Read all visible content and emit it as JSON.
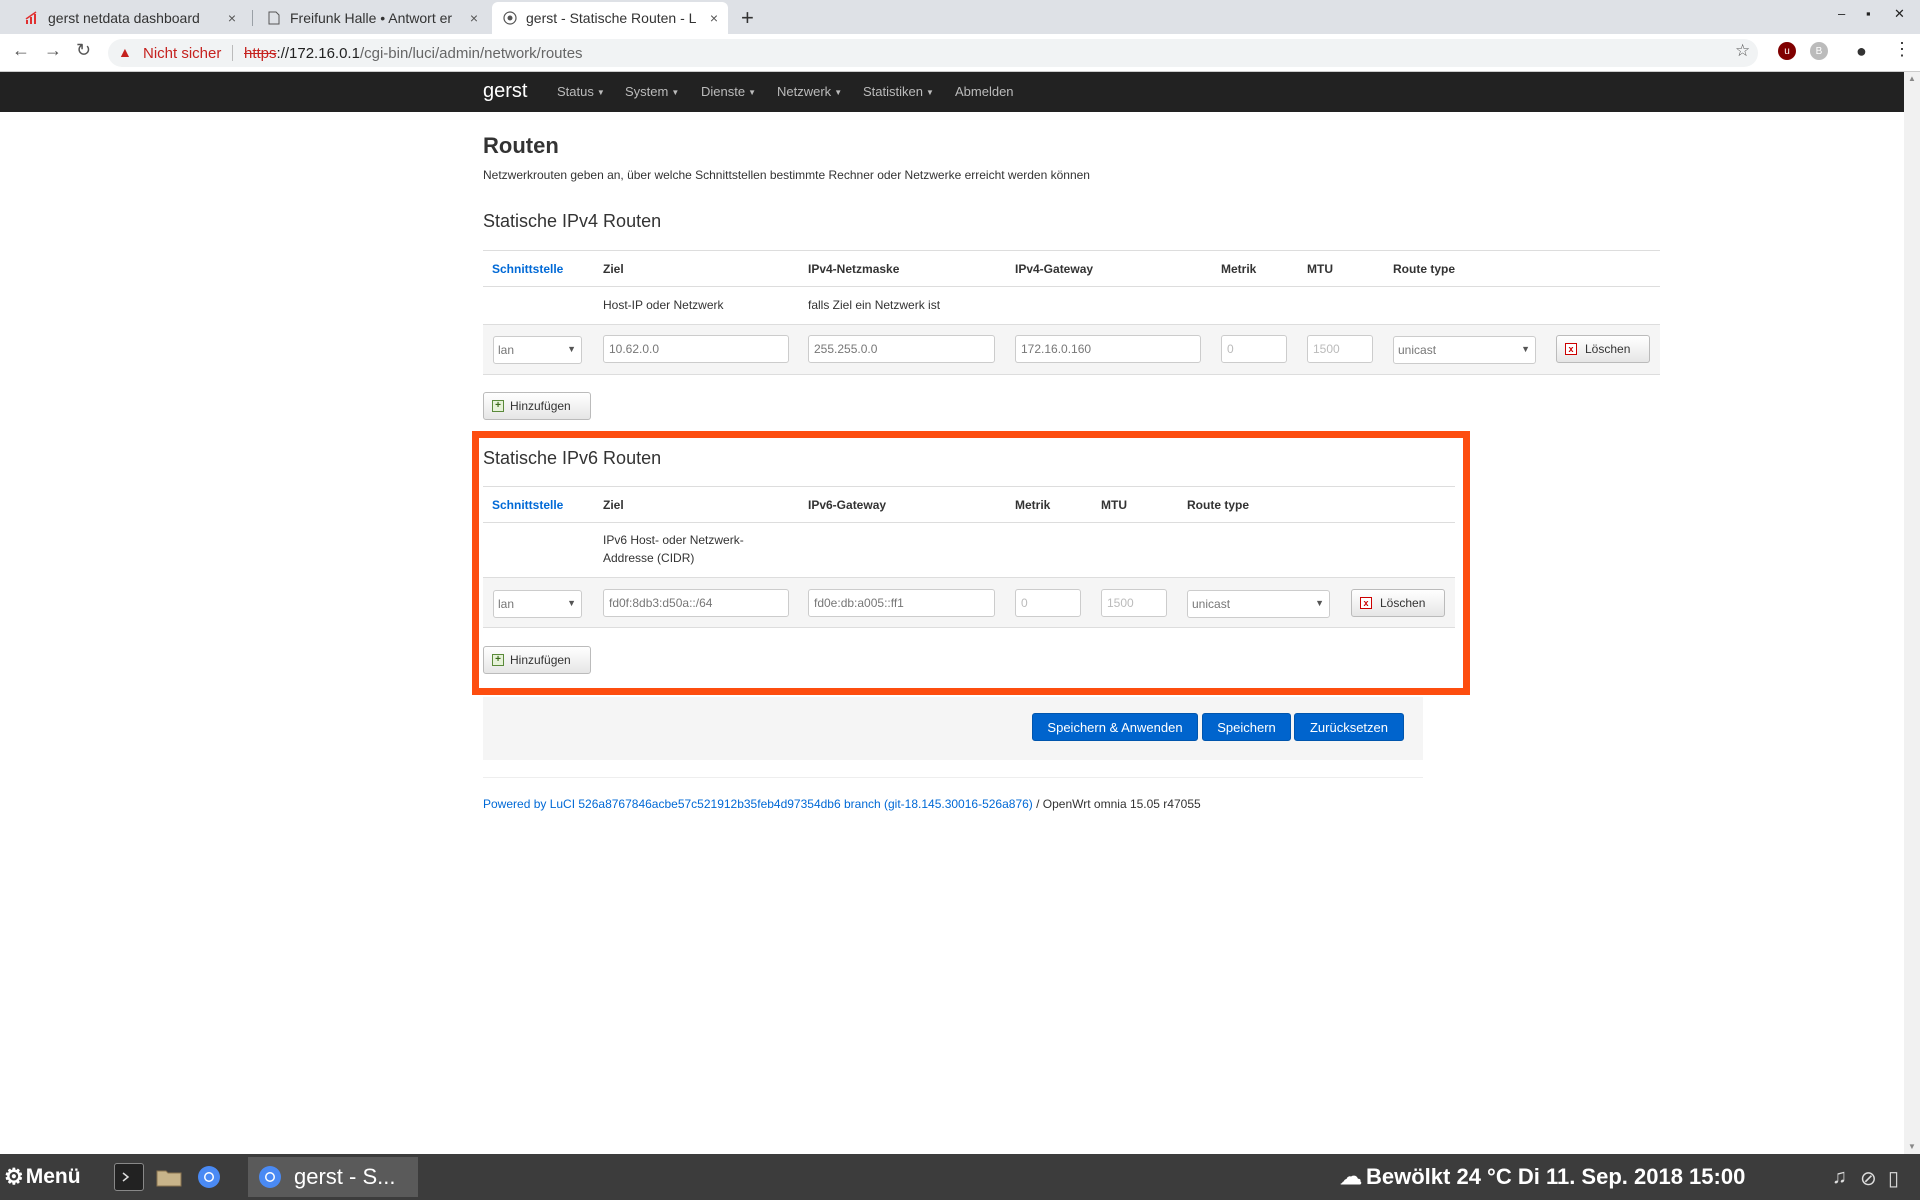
{
  "browser": {
    "tabs": [
      {
        "title": "gerst netdata dashboard",
        "close": "×"
      },
      {
        "title": "Freifunk Halle • Antwort er",
        "close": "×"
      },
      {
        "title": "gerst - Statische Routen - L",
        "close": "×"
      }
    ],
    "new_tab": "+",
    "security_text": "Nicht sicher",
    "url_scheme": "https",
    "url_host": "://172.16.0.1",
    "url_path": "/cgi-bin/luci/admin/network/routes"
  },
  "luci": {
    "brand": "gerst",
    "nav": [
      "Status",
      "System",
      "Dienste",
      "Netzwerk",
      "Statistiken",
      "Abmelden"
    ]
  },
  "page": {
    "title": "Routen",
    "description": "Netzwerkrouten geben an, über welche Schnittstellen bestimmte Rechner oder Netzwerke erreicht werden können"
  },
  "ipv4": {
    "heading": "Statische IPv4 Routen",
    "columns": [
      "Schnittstelle",
      "Ziel",
      "IPv4-Netzmaske",
      "IPv4-Gateway",
      "Metrik",
      "MTU",
      "Route type"
    ],
    "hints": {
      "ziel": "Host-IP oder Netzwerk",
      "netmask": "falls Ziel ein Netzwerk ist"
    },
    "row": {
      "interface": "lan",
      "target": "10.62.0.0",
      "netmask": "255.255.0.0",
      "gateway": "172.16.0.160",
      "metric": "0",
      "mtu": "1500",
      "route_type": "unicast"
    },
    "delete_label": "Löschen",
    "add_label": "Hinzufügen"
  },
  "ipv6": {
    "heading": "Statische IPv6 Routen",
    "columns": [
      "Schnittstelle",
      "Ziel",
      "IPv6-Gateway",
      "Metrik",
      "MTU",
      "Route type"
    ],
    "hints": {
      "ziel_line1": "IPv6 Host- oder Netzwerk-",
      "ziel_line2": "Addresse (CIDR)"
    },
    "row": {
      "interface": "lan",
      "target": "fd0f:8db3:d50a::/64",
      "gateway": "fd0e:db:a005::ff1",
      "metric": "0",
      "mtu": "1500",
      "route_type": "unicast"
    },
    "delete_label": "Löschen",
    "add_label": "Hinzufügen"
  },
  "actions": {
    "save_apply": "Speichern & Anwenden",
    "save": "Speichern",
    "reset": "Zurücksetzen"
  },
  "footer": {
    "luci_link": "Powered by LuCI 526a8767846acbe57c521912b35feb4d97354db6 branch (git-18.145.30016-526a876)",
    "rest": " / OpenWrt omnia 15.05 r47055"
  },
  "taskbar": {
    "menu": "Menü",
    "task_label": "gerst - S...",
    "weather": "Bewölkt 24 °C Di 11. Sep. 2018 15:00"
  },
  "colors": {
    "highlight": "#fd4d0f",
    "primary_button": "#0064cd",
    "luci_bar": "#222222"
  }
}
